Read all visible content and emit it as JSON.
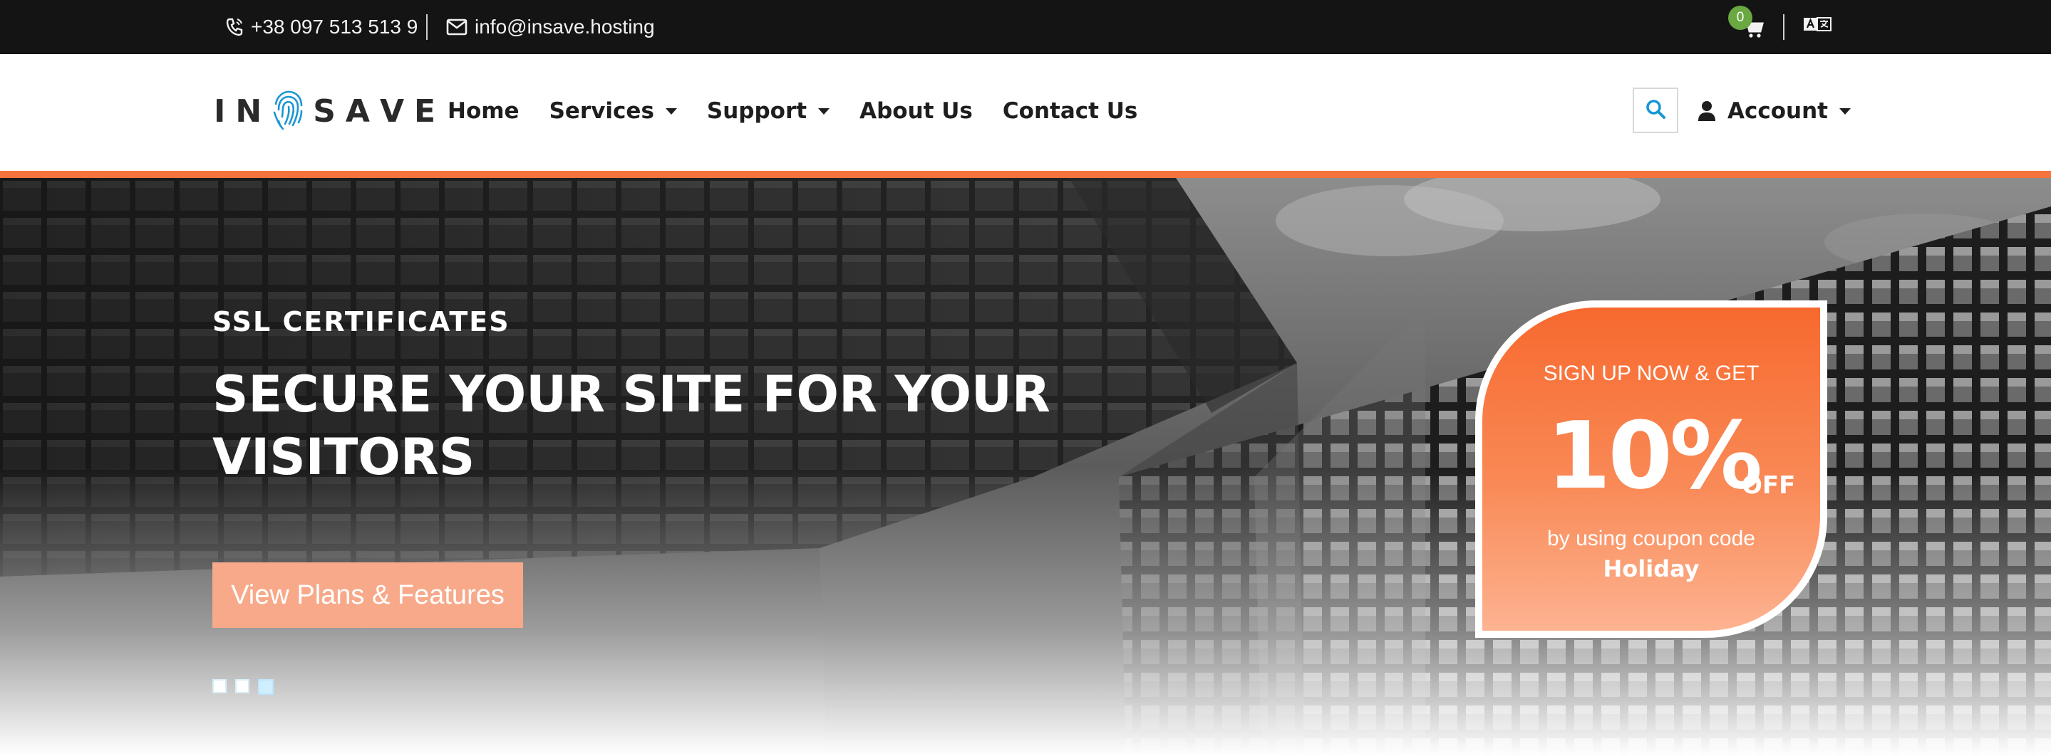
{
  "topbar": {
    "phone": "+38 097 513 513 9",
    "email": "info@insave.hosting",
    "cart_count": "0",
    "icons": {
      "phone": "phone-icon",
      "email": "envelope-icon",
      "cart": "cart-icon",
      "language": "translate-icon"
    }
  },
  "header": {
    "logo_text": [
      "I",
      "N",
      "S",
      "A",
      "V",
      "E"
    ],
    "logo_mark": "fingerprint-icon",
    "nav": [
      {
        "label": "Home"
      },
      {
        "label": "Services"
      },
      {
        "label": "Support"
      },
      {
        "label": "About Us"
      },
      {
        "label": "Contact Us"
      }
    ],
    "account_label": "Account",
    "search_icon": "search-icon",
    "user_icon": "user-icon"
  },
  "hero": {
    "eyebrow": "SSL CERTIFICATES",
    "headline_line1": "SECURE YOUR SITE FOR YOUR",
    "headline_line2": "VISITORS",
    "cta_label": "View Plans & Features",
    "slides_count": 3,
    "active_slide": 3
  },
  "promo": {
    "line1": "SIGN UP NOW & GET",
    "amount": "10%",
    "suffix": "OFF",
    "line2": "by using coupon code",
    "code": "Holiday"
  },
  "colors": {
    "topbar_bg": "#141414",
    "accent_orange": "#f5733c",
    "cta_bg": "#f7a98a",
    "badge_green": "#6aa841",
    "search_blue": "#1597d6"
  }
}
